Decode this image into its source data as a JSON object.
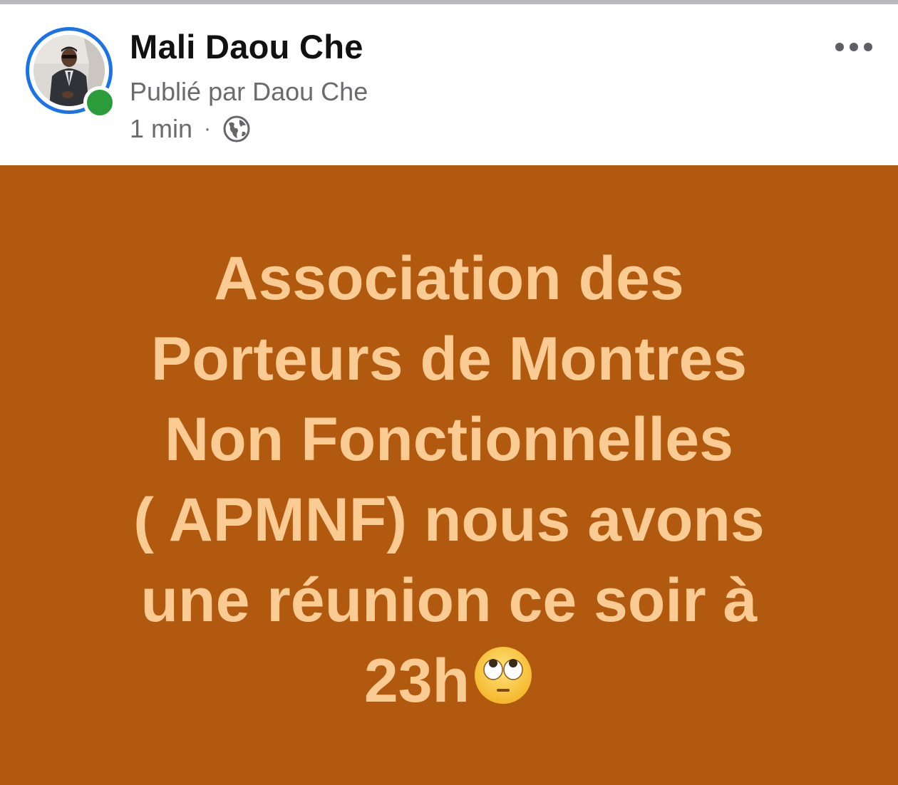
{
  "post": {
    "author_name": "Mali Daou Che",
    "published_by": "Publié par Daou Che",
    "time_ago": "1 min",
    "separator": "·",
    "privacy_icon": "globe-icon",
    "more_icon": "more-options-icon",
    "online_status": "online",
    "body_text": "Association des\nPorteurs de Montres\nNon Fonctionnelles\n( APMNF) nous avons\nune réunion ce soir à\n23h",
    "emoji": "eye-roll-emoji",
    "colors": {
      "background": "#b15a0f",
      "text": "#fbcb94",
      "online": "#2a9d3a",
      "ring": "#1a73e8"
    }
  }
}
